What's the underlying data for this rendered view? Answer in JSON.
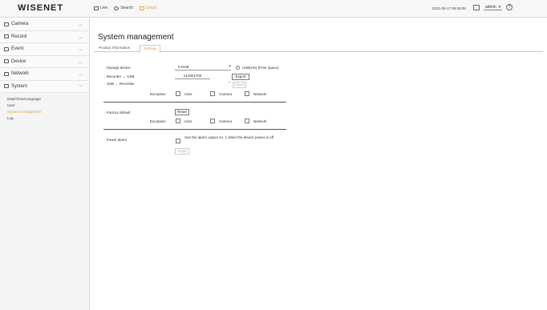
{
  "header": {
    "logo": "WISENET",
    "nav": [
      {
        "label": "Live"
      },
      {
        "label": "Search"
      },
      {
        "label": "Setup"
      }
    ],
    "datetime": "2021-05-17 09:45:59",
    "user": "admin"
  },
  "sidebar": {
    "items": [
      {
        "label": "Camera"
      },
      {
        "label": "Record"
      },
      {
        "label": "Event"
      },
      {
        "label": "Device"
      },
      {
        "label": "Network"
      },
      {
        "label": "System"
      }
    ],
    "system_sub": [
      {
        "label": "Date/Time/Language"
      },
      {
        "label": "User"
      },
      {
        "label": "System management"
      },
      {
        "label": "Log"
      }
    ]
  },
  "main": {
    "title": "System management",
    "tabs": [
      {
        "label": "Product Information"
      },
      {
        "label": "Settings"
      }
    ],
    "storage_device_label": "Storage device",
    "storage_device_value": "8 DGB",
    "storage_speed_label": "USB(HS) (Free space)",
    "recorder_to_usb_label": "Recorder → USB",
    "recorder_to_usb_value": "21/05/1700",
    "export_label": "Export",
    "usb_to_recorder_label": "USB → Recorder",
    "import_label": "Import",
    "exception_label": "Exception",
    "opt_user": "User",
    "opt_camera": "Camera",
    "opt_network": "Network",
    "factory_default_label": "Factory default",
    "reset_label": "Reset",
    "power_alarm_label": "Power alarm",
    "power_alarm_text": "Use the alarm output no. 1 when the device power is off",
    "apply_label": "Apply"
  }
}
